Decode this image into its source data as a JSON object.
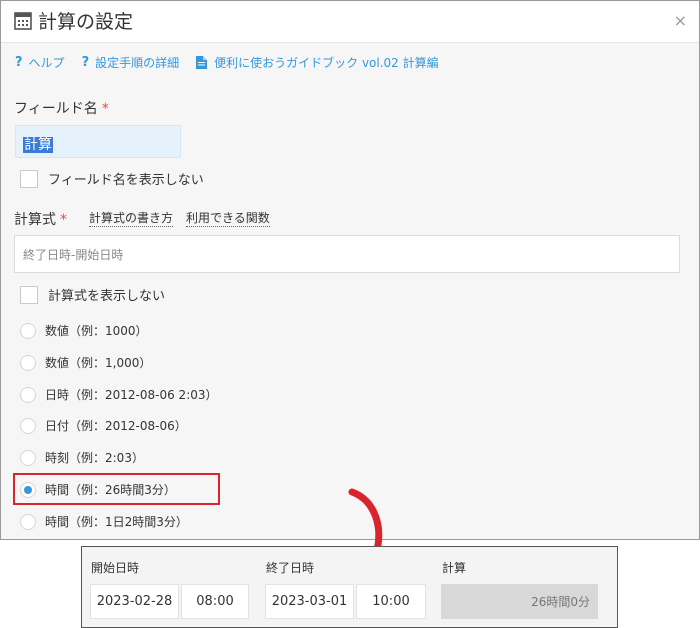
{
  "dialog": {
    "title": "計算の設定",
    "close_label": "×",
    "header_icon": "calculator-icon",
    "links": {
      "help": "ヘルプ",
      "steps": "設定手順の詳細",
      "guidebook": "便利に使おうガイドブック vol.02 計算編",
      "help_icon": "?",
      "doc_icon": "document-icon"
    }
  },
  "field_name": {
    "label": "フィールド名",
    "required_mark": "*",
    "value": "計算",
    "hide_label": "フィールド名を表示しない"
  },
  "formula": {
    "label": "計算式",
    "required_mark": "*",
    "howto_link": "計算式の書き方",
    "functions_link": "利用できる関数",
    "placeholder": "終了日時-開始日時",
    "hide_label": "計算式を表示しない"
  },
  "formats": [
    {
      "label": "数値（例：1000）",
      "checked": false
    },
    {
      "label": "数値（例：1,000）",
      "checked": false
    },
    {
      "label": "日時（例：2012-08-06 2:03）",
      "checked": false
    },
    {
      "label": "日付（例：2012-08-06）",
      "checked": false
    },
    {
      "label": "時刻（例：2:03）",
      "checked": false
    },
    {
      "label": "時間（例：26時間3分）",
      "checked": true
    },
    {
      "label": "時間（例：1日2時間3分）",
      "checked": false
    }
  ],
  "preview": {
    "start_label": "開始日時",
    "start_date": "2023-02-28",
    "start_time": "08:00",
    "end_label": "終了日時",
    "end_date": "2023-03-01",
    "end_time": "10:00",
    "calc_label": "計算",
    "calc_value": "26時間0分"
  },
  "colors": {
    "accent": "#3498db",
    "required": "#e74c3c",
    "highlight": "#d9232d",
    "arrow": "#d9232d"
  }
}
